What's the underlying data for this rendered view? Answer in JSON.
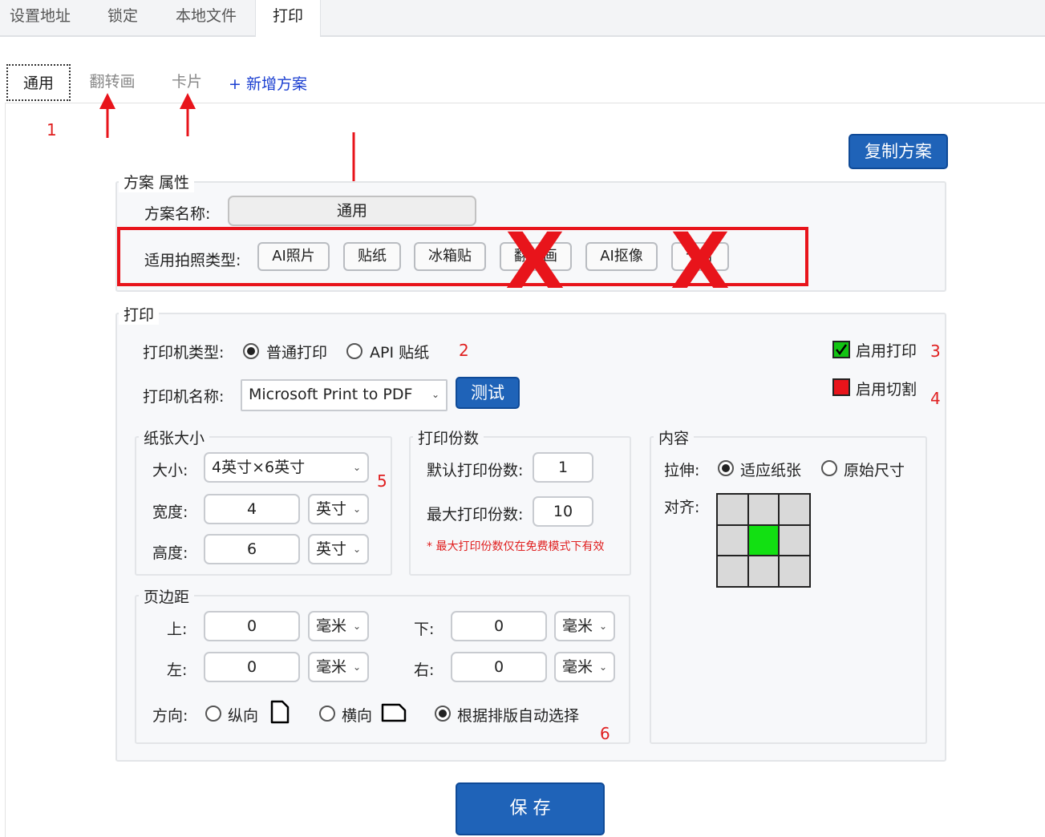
{
  "top_tabs": [
    "设置地址",
    "锁定",
    "本地文件",
    "打印"
  ],
  "sub_tabs": [
    "通用",
    "翻转画",
    "卡片"
  ],
  "add_plan": "+ 新增方案",
  "copy_plan_button": "复制方案",
  "plan_props": {
    "legend": "方案 属性",
    "name_label": "方案名称:",
    "name_value": "通用",
    "photo_types_label": "适用拍照类型:",
    "photo_types": [
      "AI照片",
      "贴纸",
      "冰箱贴",
      "翻转画",
      "AI抠像",
      "卡片"
    ]
  },
  "print": {
    "legend": "打印",
    "printer_type_label": "打印机类型:",
    "printer_type_options": [
      "普通打印",
      "API 贴纸"
    ],
    "printer_type_selected": "普通打印",
    "enable_print": "启用打印",
    "enable_cut": "启用切割",
    "printer_name_label": "打印机名称:",
    "printer_name_value": "Microsoft Print to PDF",
    "test_button": "测试"
  },
  "paper_size": {
    "legend": "纸张大小",
    "size_label": "大小:",
    "size_value": "4英寸×6英寸",
    "width_label": "宽度:",
    "width_value": "4",
    "width_unit": "英寸",
    "height_label": "高度:",
    "height_value": "6",
    "height_unit": "英寸"
  },
  "copies": {
    "legend": "打印份数",
    "default_label": "默认打印份数:",
    "default_value": "1",
    "max_label": "最大打印份数:",
    "max_value": "10",
    "note": "* 最大打印份数仅在免费模式下有效"
  },
  "content": {
    "legend": "内容",
    "stretch_label": "拉伸:",
    "stretch_options": [
      "适应纸张",
      "原始尺寸"
    ],
    "stretch_selected": "适应纸张",
    "align_label": "对齐:",
    "align_selected": "center"
  },
  "margins": {
    "legend": "页边距",
    "top_label": "上:",
    "top_value": "0",
    "top_unit": "毫米",
    "bottom_label": "下:",
    "bottom_value": "0",
    "bottom_unit": "毫米",
    "left_label": "左:",
    "left_value": "0",
    "left_unit": "毫米",
    "right_label": "右:",
    "right_value": "0",
    "right_unit": "毫米",
    "orientation_label": "方向:",
    "orientation_options": [
      "纵向",
      "横向",
      "根据排版自动选择"
    ],
    "orientation_selected": "根据排版自动选择"
  },
  "save_button": "保 存",
  "annotations": [
    "1",
    "2",
    "3",
    "4",
    "5",
    "6"
  ],
  "colors": {
    "accent": "#1f63b8",
    "annotation_red": "#e8141b",
    "enable_print_green": "#12c412",
    "enable_cut_red": "#e8141b",
    "align_selected": "#12e012"
  }
}
